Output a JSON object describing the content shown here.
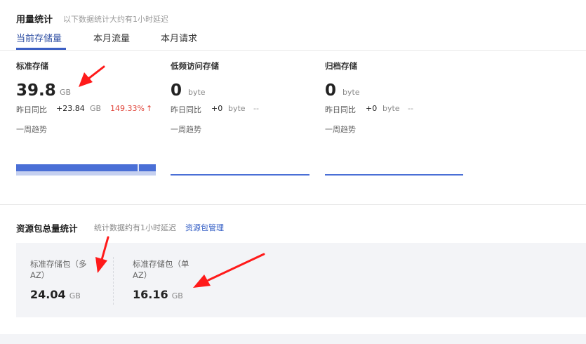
{
  "header": {
    "title": "用量统计",
    "note": "以下数据统计大约有1小时延迟"
  },
  "tabs": [
    {
      "label": "当前存储量",
      "active": true
    },
    {
      "label": "本月流量",
      "active": false
    },
    {
      "label": "本月请求",
      "active": false
    }
  ],
  "metrics": [
    {
      "label": "标准存储",
      "value": "39.8",
      "unit": "GB",
      "cmp_label": "昨日同比",
      "cmp_delta": "+23.84",
      "cmp_unit": "GB",
      "cmp_pct": "149.33%",
      "trend_label": "一周趋势",
      "trend_level": 0.75
    },
    {
      "label": "低频访问存储",
      "value": "0",
      "unit": "byte",
      "cmp_label": "昨日同比",
      "cmp_delta": "+0",
      "cmp_unit": "byte",
      "cmp_dash": "--",
      "trend_label": "一周趋势",
      "trend_level": 0
    },
    {
      "label": "归档存储",
      "value": "0",
      "unit": "byte",
      "cmp_label": "昨日同比",
      "cmp_delta": "+0",
      "cmp_unit": "byte",
      "cmp_dash": "--",
      "trend_label": "一周趋势",
      "trend_level": 0
    }
  ],
  "packages": {
    "title": "资源包总量统计",
    "note": "统计数据约有1小时延迟",
    "link": "资源包管理",
    "items": [
      {
        "label": "标准存储包（多AZ）",
        "value": "24.04",
        "unit": "GB"
      },
      {
        "label": "标准存储包（单AZ）",
        "value": "16.16",
        "unit": "GB"
      }
    ]
  },
  "colors": {
    "accent": "#3b5fc4",
    "spark_fill": "#4a6fd6",
    "spark_light": "#c5d0f0",
    "increase": "#e0453a",
    "annotation_arrow": "#ff1a1a"
  },
  "icons": {
    "up_arrow": "↑"
  }
}
